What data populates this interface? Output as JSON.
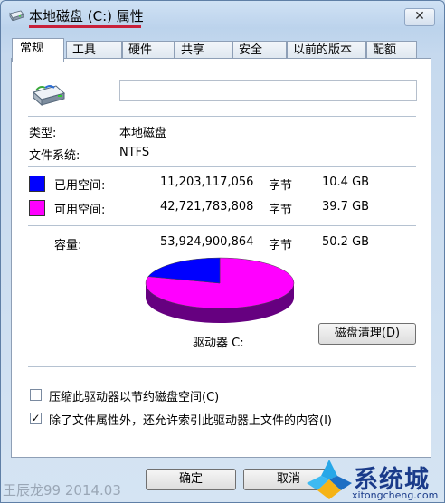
{
  "window": {
    "title": "本地磁盘 (C:) 属性",
    "close_label": "✕"
  },
  "tabs": [
    {
      "label": "常规",
      "active": true
    },
    {
      "label": "工具"
    },
    {
      "label": "硬件"
    },
    {
      "label": "共享"
    },
    {
      "label": "安全"
    },
    {
      "label": "以前的版本"
    },
    {
      "label": "配额"
    }
  ],
  "general": {
    "name_value": "",
    "type_label": "类型:",
    "type_value": "本地磁盘",
    "fs_label": "文件系统:",
    "fs_value": "NTFS",
    "used": {
      "label": "已用空间:",
      "bytes": "11,203,117,056",
      "unit": "字节",
      "size": "10.4 GB",
      "color": "#0000ff"
    },
    "free": {
      "label": "可用空间:",
      "bytes": "42,721,783,808",
      "unit": "字节",
      "size": "39.7 GB",
      "color": "#ff00ff"
    },
    "capacity": {
      "label": "容量:",
      "bytes": "53,924,900,864",
      "unit": "字节",
      "size": "50.2 GB"
    },
    "drive_label": "驱动器 C:",
    "cleanup_button": "磁盘清理(D)",
    "used_fraction": 0.2077
  },
  "options": {
    "compress": {
      "label": "压缩此驱动器以节约磁盘空间(C)",
      "checked": false
    },
    "index": {
      "label": "除了文件属性外，还允许索引此驱动器上文件的内容(I)",
      "checked": true,
      "mark": "✓"
    }
  },
  "buttons": {
    "ok": "确定",
    "cancel": "取消"
  },
  "watermark": {
    "text": "王辰龙99 2014.03",
    "site_name": "系统城",
    "site_url": "xitongcheng.com"
  }
}
